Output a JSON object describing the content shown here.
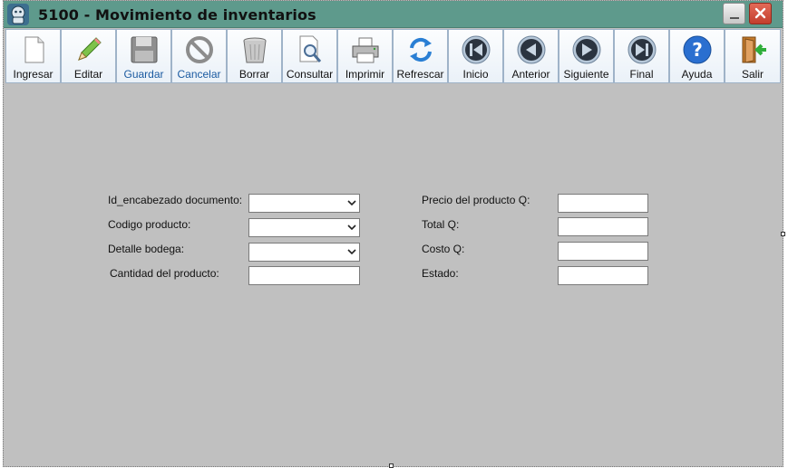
{
  "window": {
    "title": "5100 - Movimiento de inventarios"
  },
  "toolbar": {
    "buttons": [
      {
        "id": "ingresar",
        "label": "Ingresar",
        "icon": "new-document-icon",
        "enabled": true
      },
      {
        "id": "editar",
        "label": "Editar",
        "icon": "pencil-icon",
        "enabled": true
      },
      {
        "id": "guardar",
        "label": "Guardar",
        "icon": "floppy-disk-icon",
        "enabled": false
      },
      {
        "id": "cancelar",
        "label": "Cancelar",
        "icon": "cancel-circle-icon",
        "enabled": false
      },
      {
        "id": "borrar",
        "label": "Borrar",
        "icon": "trash-can-icon",
        "enabled": true
      },
      {
        "id": "consultar",
        "label": "Consultar",
        "icon": "search-document-icon",
        "enabled": true
      },
      {
        "id": "imprimir",
        "label": "Imprimir",
        "icon": "printer-icon",
        "enabled": true
      },
      {
        "id": "refrescar",
        "label": "Refrescar",
        "icon": "refresh-icon",
        "enabled": true
      },
      {
        "id": "inicio",
        "label": "Inicio",
        "icon": "first-record-icon",
        "enabled": true
      },
      {
        "id": "anterior",
        "label": "Anterior",
        "icon": "previous-record-icon",
        "enabled": true
      },
      {
        "id": "siguiente",
        "label": "Siguiente",
        "icon": "next-record-icon",
        "enabled": true
      },
      {
        "id": "final",
        "label": "Final",
        "icon": "last-record-icon",
        "enabled": true
      },
      {
        "id": "ayuda",
        "label": "Ayuda",
        "icon": "help-icon",
        "enabled": true
      },
      {
        "id": "salir",
        "label": "Salir",
        "icon": "exit-door-icon",
        "enabled": true
      }
    ]
  },
  "form": {
    "left": [
      {
        "label": "Id_encabezado documento:",
        "type": "combo",
        "value": ""
      },
      {
        "label": "Codigo producto:",
        "type": "combo",
        "value": ""
      },
      {
        "label": "Detalle bodega:",
        "type": "combo",
        "value": ""
      },
      {
        "label": "Cantidad del producto:",
        "type": "text",
        "value": ""
      }
    ],
    "right": [
      {
        "label": "Precio del producto Q:",
        "type": "text",
        "value": ""
      },
      {
        "label": "Total Q:",
        "type": "text",
        "value": ""
      },
      {
        "label": "Costo Q:",
        "type": "text",
        "value": ""
      },
      {
        "label": "Estado:",
        "type": "text",
        "value": ""
      }
    ]
  },
  "colors": {
    "titlebar": "#5e9a8c",
    "client_background": "#c0c0c0",
    "disabled_label": "#1a5aa0",
    "close_button": "#c33e2d"
  }
}
